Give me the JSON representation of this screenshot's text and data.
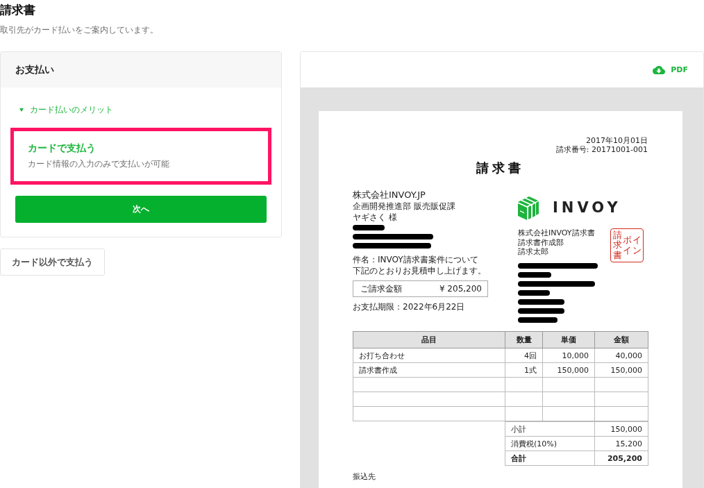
{
  "page": {
    "title": "請求書",
    "subtitle": "取引先がカード払いをご案内しています。"
  },
  "payment_card": {
    "heading": "お支払い",
    "benefits_toggle": "カード払いのメリット",
    "card_option": {
      "title": "カードで支払う",
      "description": "カード情報の入力のみで支払いが可能",
      "selected": true
    },
    "next_button": "次へ"
  },
  "other_payment_button": "カード以外で支払う",
  "preview": {
    "pdf_button": "PDF",
    "document": {
      "date": "2017年10月01日",
      "invoice_number": "請求番号: 20171001-001",
      "title": "請求書",
      "recipient": {
        "company": "株式会社INVOY.JP",
        "department": "企画開発推進部 販売販促課",
        "name": "ヤギさく 様",
        "redacted": true
      },
      "subject": "件名：INVOY請求書案件について",
      "message": "下記のとおりお見積申し上げます。",
      "amount_box": {
        "label": "ご請求金額",
        "value": "¥ 205,200"
      },
      "due_date": "お支払期限：2022年6月22日",
      "issuer": {
        "logo_text": "INVOY",
        "lines": [
          "株式会社INVOY請求書",
          "請求書作成部",
          "請求太郎"
        ],
        "stamp": [
          "請求書",
          "ボイ",
          "イン"
        ],
        "redacted": true
      },
      "table": {
        "columns": [
          "品目",
          "数量",
          "単価",
          "金額"
        ],
        "rows": [
          {
            "kind": "item",
            "item": "お打ち合わせ",
            "quantity": "4回",
            "unit_price": "10,000",
            "amount": "40,000"
          },
          {
            "kind": "item",
            "item": "請求書作成",
            "quantity": "1式",
            "unit_price": "150,000",
            "amount": "150,000"
          },
          {
            "kind": "blank"
          },
          {
            "kind": "blank"
          },
          {
            "kind": "blank"
          }
        ]
      },
      "summary": [
        {
          "kind": "normal",
          "label": "小計",
          "value": "150,000"
        },
        {
          "kind": "normal",
          "label": "消費税(10%)",
          "value": "15,200"
        },
        {
          "kind": "total",
          "label": "合計",
          "value": "205,200"
        }
      ],
      "bank_heading": "振込先"
    }
  }
}
